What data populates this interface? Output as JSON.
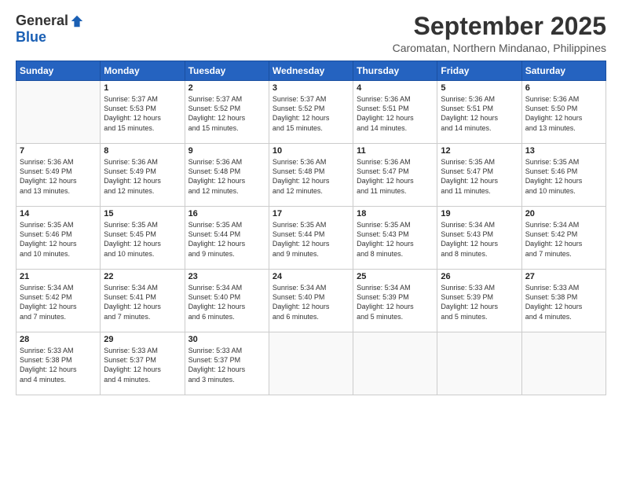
{
  "logo": {
    "general": "General",
    "blue": "Blue"
  },
  "title": "September 2025",
  "location": "Caromatan, Northern Mindanao, Philippines",
  "days": [
    "Sunday",
    "Monday",
    "Tuesday",
    "Wednesday",
    "Thursday",
    "Friday",
    "Saturday"
  ],
  "weeks": [
    [
      {
        "day": "",
        "content": ""
      },
      {
        "day": "1",
        "content": "Sunrise: 5:37 AM\nSunset: 5:53 PM\nDaylight: 12 hours\nand 15 minutes."
      },
      {
        "day": "2",
        "content": "Sunrise: 5:37 AM\nSunset: 5:52 PM\nDaylight: 12 hours\nand 15 minutes."
      },
      {
        "day": "3",
        "content": "Sunrise: 5:37 AM\nSunset: 5:52 PM\nDaylight: 12 hours\nand 15 minutes."
      },
      {
        "day": "4",
        "content": "Sunrise: 5:36 AM\nSunset: 5:51 PM\nDaylight: 12 hours\nand 14 minutes."
      },
      {
        "day": "5",
        "content": "Sunrise: 5:36 AM\nSunset: 5:51 PM\nDaylight: 12 hours\nand 14 minutes."
      },
      {
        "day": "6",
        "content": "Sunrise: 5:36 AM\nSunset: 5:50 PM\nDaylight: 12 hours\nand 13 minutes."
      }
    ],
    [
      {
        "day": "7",
        "content": "Sunrise: 5:36 AM\nSunset: 5:49 PM\nDaylight: 12 hours\nand 13 minutes."
      },
      {
        "day": "8",
        "content": "Sunrise: 5:36 AM\nSunset: 5:49 PM\nDaylight: 12 hours\nand 12 minutes."
      },
      {
        "day": "9",
        "content": "Sunrise: 5:36 AM\nSunset: 5:48 PM\nDaylight: 12 hours\nand 12 minutes."
      },
      {
        "day": "10",
        "content": "Sunrise: 5:36 AM\nSunset: 5:48 PM\nDaylight: 12 hours\nand 12 minutes."
      },
      {
        "day": "11",
        "content": "Sunrise: 5:36 AM\nSunset: 5:47 PM\nDaylight: 12 hours\nand 11 minutes."
      },
      {
        "day": "12",
        "content": "Sunrise: 5:35 AM\nSunset: 5:47 PM\nDaylight: 12 hours\nand 11 minutes."
      },
      {
        "day": "13",
        "content": "Sunrise: 5:35 AM\nSunset: 5:46 PM\nDaylight: 12 hours\nand 10 minutes."
      }
    ],
    [
      {
        "day": "14",
        "content": "Sunrise: 5:35 AM\nSunset: 5:46 PM\nDaylight: 12 hours\nand 10 minutes."
      },
      {
        "day": "15",
        "content": "Sunrise: 5:35 AM\nSunset: 5:45 PM\nDaylight: 12 hours\nand 10 minutes."
      },
      {
        "day": "16",
        "content": "Sunrise: 5:35 AM\nSunset: 5:44 PM\nDaylight: 12 hours\nand 9 minutes."
      },
      {
        "day": "17",
        "content": "Sunrise: 5:35 AM\nSunset: 5:44 PM\nDaylight: 12 hours\nand 9 minutes."
      },
      {
        "day": "18",
        "content": "Sunrise: 5:35 AM\nSunset: 5:43 PM\nDaylight: 12 hours\nand 8 minutes."
      },
      {
        "day": "19",
        "content": "Sunrise: 5:34 AM\nSunset: 5:43 PM\nDaylight: 12 hours\nand 8 minutes."
      },
      {
        "day": "20",
        "content": "Sunrise: 5:34 AM\nSunset: 5:42 PM\nDaylight: 12 hours\nand 7 minutes."
      }
    ],
    [
      {
        "day": "21",
        "content": "Sunrise: 5:34 AM\nSunset: 5:42 PM\nDaylight: 12 hours\nand 7 minutes."
      },
      {
        "day": "22",
        "content": "Sunrise: 5:34 AM\nSunset: 5:41 PM\nDaylight: 12 hours\nand 7 minutes."
      },
      {
        "day": "23",
        "content": "Sunrise: 5:34 AM\nSunset: 5:40 PM\nDaylight: 12 hours\nand 6 minutes."
      },
      {
        "day": "24",
        "content": "Sunrise: 5:34 AM\nSunset: 5:40 PM\nDaylight: 12 hours\nand 6 minutes."
      },
      {
        "day": "25",
        "content": "Sunrise: 5:34 AM\nSunset: 5:39 PM\nDaylight: 12 hours\nand 5 minutes."
      },
      {
        "day": "26",
        "content": "Sunrise: 5:33 AM\nSunset: 5:39 PM\nDaylight: 12 hours\nand 5 minutes."
      },
      {
        "day": "27",
        "content": "Sunrise: 5:33 AM\nSunset: 5:38 PM\nDaylight: 12 hours\nand 4 minutes."
      }
    ],
    [
      {
        "day": "28",
        "content": "Sunrise: 5:33 AM\nSunset: 5:38 PM\nDaylight: 12 hours\nand 4 minutes."
      },
      {
        "day": "29",
        "content": "Sunrise: 5:33 AM\nSunset: 5:37 PM\nDaylight: 12 hours\nand 4 minutes."
      },
      {
        "day": "30",
        "content": "Sunrise: 5:33 AM\nSunset: 5:37 PM\nDaylight: 12 hours\nand 3 minutes."
      },
      {
        "day": "",
        "content": ""
      },
      {
        "day": "",
        "content": ""
      },
      {
        "day": "",
        "content": ""
      },
      {
        "day": "",
        "content": ""
      }
    ]
  ]
}
